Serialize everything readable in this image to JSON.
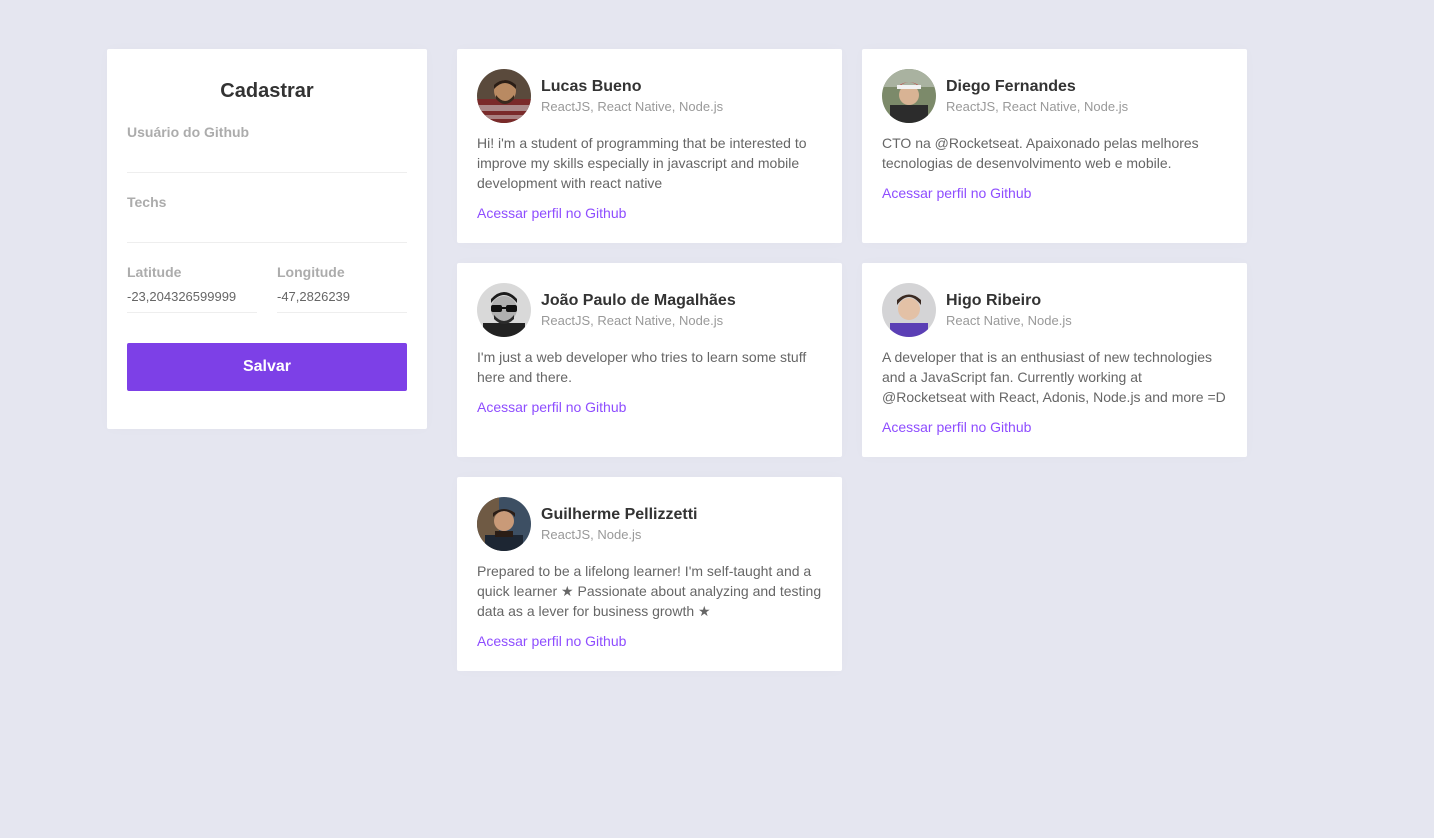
{
  "form": {
    "title": "Cadastrar",
    "github_label": "Usuário do Github",
    "github_value": "",
    "techs_label": "Techs",
    "techs_value": "",
    "latitude_label": "Latitude",
    "latitude_value": "-23,204326599999",
    "longitude_label": "Longitude",
    "longitude_value": "-47,2826239",
    "save_label": "Salvar"
  },
  "colors": {
    "background": "#e5e6f0",
    "accent": "#7d40e7",
    "link": "#8e4dff"
  },
  "devs": [
    {
      "name": "Lucas Bueno",
      "techs": "ReactJS, React Native, Node.js",
      "bio": "Hi! i'm a student of programming that be interested to improve my skills especially in javascript and mobile development with react native",
      "link": "Acessar perfil no Github"
    },
    {
      "name": "Diego Fernandes",
      "techs": "ReactJS, React Native, Node.js",
      "bio": "CTO na @Rocketseat. Apaixonado pelas melhores tecnologias de desenvolvimento web e mobile.",
      "link": "Acessar perfil no Github"
    },
    {
      "name": "João Paulo de Magalhães",
      "techs": "ReactJS, React Native, Node.js",
      "bio": "I'm just a web developer who tries to learn some stuff here and there.",
      "link": "Acessar perfil no Github"
    },
    {
      "name": "Higo Ribeiro",
      "techs": "React Native, Node.js",
      "bio": "A developer that is an enthusiast of new technologies and a JavaScript fan. Currently working at @Rocketseat with React, Adonis, Node.js and more =D",
      "link": "Acessar perfil no Github"
    },
    {
      "name": "Guilherme Pellizzetti",
      "techs": "ReactJS, Node.js",
      "bio": "Prepared to be a lifelong learner! I'm self-taught and a quick learner ★ Passionate about analyzing and testing data as a lever for business growth ★",
      "link": "Acessar perfil no Github"
    }
  ]
}
